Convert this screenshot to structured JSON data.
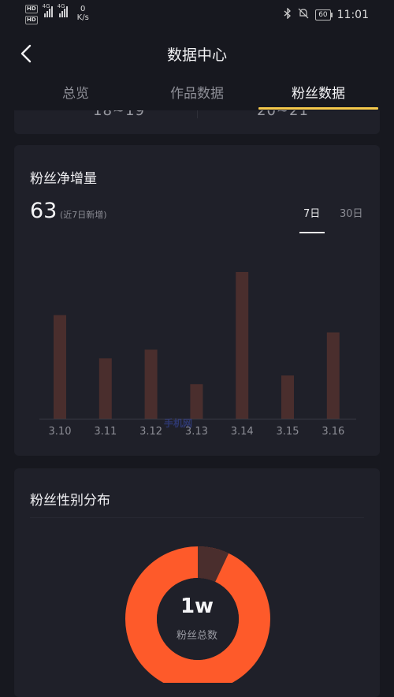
{
  "status_bar": {
    "hd1": "HD",
    "hd2": "HD",
    "net1": "4G",
    "net2": "4G",
    "speed_value": "0",
    "speed_unit": "K/s",
    "battery": "60",
    "time": "11:01"
  },
  "nav": {
    "title": "数据中心"
  },
  "tabs": [
    {
      "label": "总览"
    },
    {
      "label": "作品数据"
    },
    {
      "label": "粉丝数据"
    }
  ],
  "peek": {
    "left_text": "18~19",
    "right_text": "20~21"
  },
  "fans_growth": {
    "title": "粉丝净增量",
    "value": "63",
    "value_note": "(近7日新增)",
    "range_options": [
      "7日",
      "30日"
    ],
    "selected_range": "7日",
    "bar_color": "#4a2e2d"
  },
  "chart_data": {
    "type": "bar",
    "categories": [
      "3.10",
      "3.11",
      "3.12",
      "3.13",
      "3.14",
      "3.15",
      "3.16"
    ],
    "values": [
      12,
      7,
      8,
      4,
      17,
      5,
      10
    ],
    "title": "粉丝净增量",
    "xlabel": "",
    "ylabel": "",
    "ylim": [
      0,
      18
    ],
    "grid": false,
    "legend": "none"
  },
  "watermark": "手机网",
  "gender": {
    "title": "粉丝性别分布",
    "total_value": "1w",
    "total_label": "粉丝总数",
    "male_fraction": 0.93,
    "female_fraction": 0.07,
    "male_color": "#fe5a2a",
    "female_color": "#4a2e2d"
  }
}
